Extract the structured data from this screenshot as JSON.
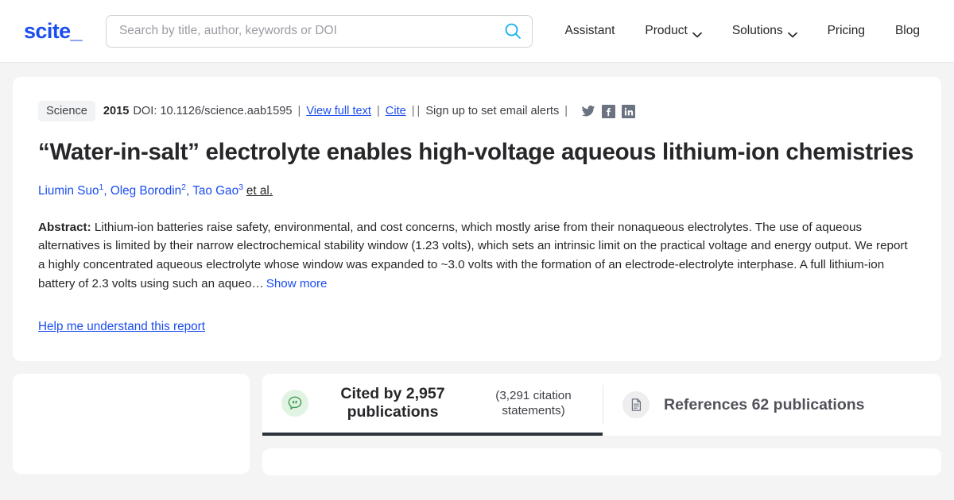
{
  "header": {
    "logo": "scite_",
    "search": {
      "placeholder": "Search by title, author, keywords or DOI",
      "value": "",
      "icon": "search-icon"
    },
    "nav": [
      {
        "label": "Assistant",
        "caret": false
      },
      {
        "label": "Product",
        "caret": true
      },
      {
        "label": "Solutions",
        "caret": true
      },
      {
        "label": "Pricing",
        "caret": false
      },
      {
        "label": "Blog",
        "caret": false
      }
    ]
  },
  "paper": {
    "journal": "Science",
    "year": "2015",
    "doi": "DOI: 10.1126/science.aab1595",
    "view_full_text": "View full text",
    "cite": "Cite",
    "email_alerts": "Sign up to set email alerts",
    "separator": "|",
    "social": [
      "twitter-icon",
      "facebook-icon",
      "linkedin-icon"
    ],
    "title": "“Water-in-salt” electrolyte enables high-voltage aqueous lithium-ion chemistries",
    "authors": [
      {
        "name": "Liumin Suo",
        "sup": "1"
      },
      {
        "name": "Oleg Borodin",
        "sup": "2"
      },
      {
        "name": "Tao Gao",
        "sup": "3"
      }
    ],
    "et_al": "et al.",
    "abstract_label": "Abstract:",
    "abstract_text": " Lithium-ion batteries raise safety, environmental, and cost concerns, which mostly arise from their nonaqueous electrolytes. The use of aqueous alternatives is limited by their narrow electrochemical stability window (1.23 volts), which sets an intrinsic limit on the practical voltage and energy output. We report a highly concentrated aqueous electrolyte whose window was expanded to ~3.0 volts with the formation of an electrode-electrolyte interphase. A full lithium-ion battery of 2.3 volts using such an aqueo…",
    "show_more": "Show more",
    "help_link": "Help me understand this report"
  },
  "tabs": [
    {
      "id": "cited-by",
      "icon": "quote-bubble-icon",
      "main": "Cited by 2,957 publications",
      "sub": "(3,291 citation statements)",
      "active": true
    },
    {
      "id": "references",
      "icon": "document-icon",
      "main": "References 62 publications",
      "sub": "",
      "active": false
    }
  ],
  "colors": {
    "brand_blue": "#1b4df0",
    "search_cyan": "#12b0f0",
    "page_bg": "#f4f4f5",
    "active_tab_underline": "#2d333a",
    "green_accent": "#3f9b50"
  }
}
